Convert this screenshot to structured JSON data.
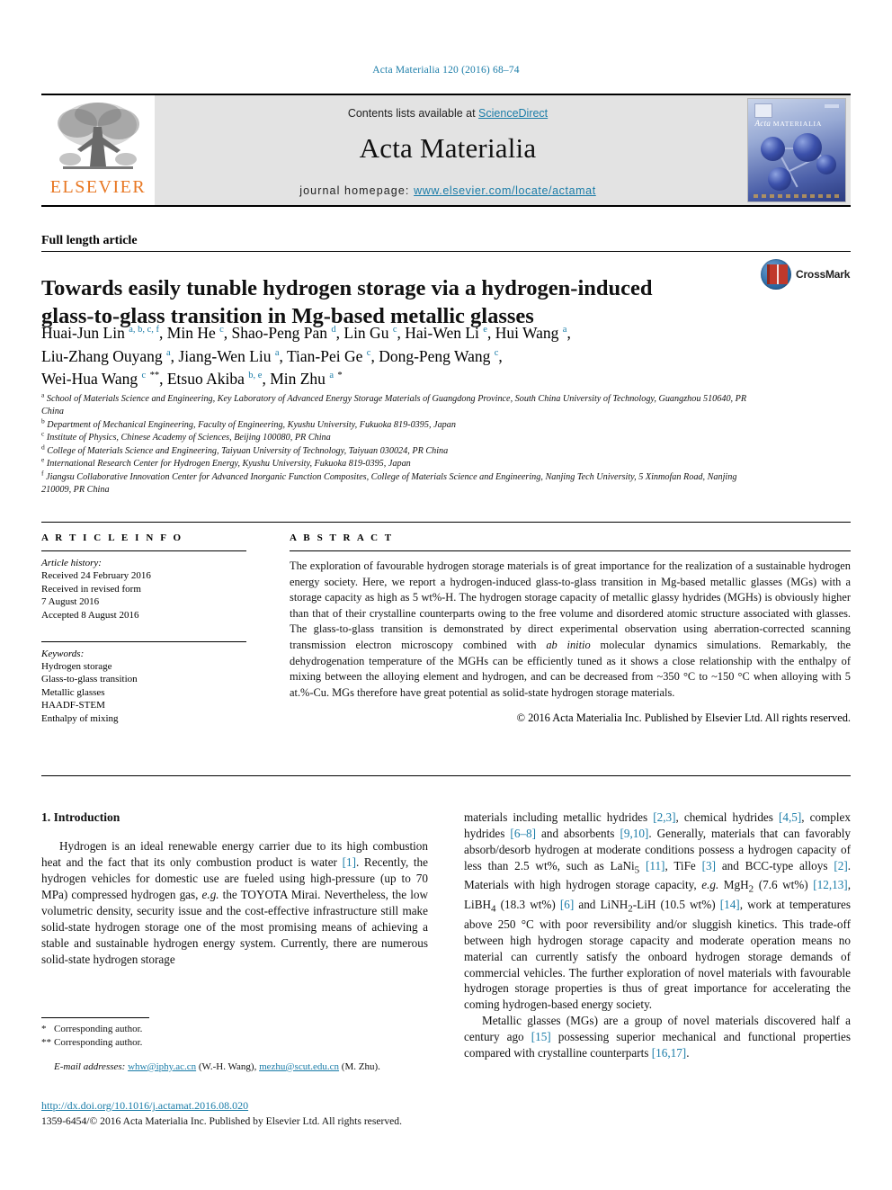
{
  "running_head": "Acta Materialia 120 (2016) 68–74",
  "masthead": {
    "contents_prefix": "Contents lists available at ",
    "sciencedirect": "ScienceDirect",
    "journal_title": "Acta Materialia",
    "homepage_prefix": "journal homepage: ",
    "homepage_url": "www.elsevier.com/locate/actamat",
    "publisher_wordmark": "ELSEVIER",
    "cover_title_italic": "Acta",
    "cover_title_rest": "MATERIALIA",
    "accent_link_color": "#1a7ca8",
    "elsevier_orange": "#e87722"
  },
  "article": {
    "type": "Full length article",
    "title": "Towards easily tunable hydrogen storage via a hydrogen-induced glass-to-glass transition in Mg-based metallic glasses",
    "crossmark_label": "CrossMark"
  },
  "authors_lines": [
    "Huai-Jun Lin a, b, c, f, Min He c, Shao-Peng Pan d, Lin Gu c, Hai-Wen Li e, Hui Wang a,",
    "Liu-Zhang Ouyang a, Jiang-Wen Liu a, Tian-Pei Ge c, Dong-Peng Wang c,",
    "Wei-Hua Wang c, **, Etsuo Akiba b, e, Min Zhu a, *"
  ],
  "affiliations": [
    {
      "marker": "a",
      "text": "School of Materials Science and Engineering, Key Laboratory of Advanced Energy Storage Materials of Guangdong Province, South China University of Technology, Guangzhou 510640, PR China"
    },
    {
      "marker": "b",
      "text": "Department of Mechanical Engineering, Faculty of Engineering, Kyushu University, Fukuoka 819-0395, Japan"
    },
    {
      "marker": "c",
      "text": "Institute of Physics, Chinese Academy of Sciences, Beijing 100080, PR China"
    },
    {
      "marker": "d",
      "text": "College of Materials Science and Engineering, Taiyuan University of Technology, Taiyuan 030024, PR China"
    },
    {
      "marker": "e",
      "text": "International Research Center for Hydrogen Energy, Kyushu University, Fukuoka 819-0395, Japan"
    },
    {
      "marker": "f",
      "text": "Jiangsu Collaborative Innovation Center for Advanced Inorganic Function Composites, College of Materials Science and Engineering, Nanjing Tech University, 5 Xinmofan Road, Nanjing 210009, PR China"
    }
  ],
  "article_info": {
    "section_label": "A R T I C L E   I N F O",
    "history_label": "Article history:",
    "history_lines": [
      "Received 24 February 2016",
      "Received in revised form",
      "7 August 2016",
      "Accepted 8 August 2016"
    ],
    "keywords_label": "Keywords:",
    "keywords": [
      "Hydrogen storage",
      "Glass-to-glass transition",
      "Metallic glasses",
      "HAADF-STEM",
      "Enthalpy of mixing"
    ]
  },
  "abstract": {
    "section_label": "A B S T R A C T",
    "text": "The exploration of favourable hydrogen storage materials is of great importance for the realization of a sustainable hydrogen energy society. Here, we report a hydrogen-induced glass-to-glass transition in Mg-based metallic glasses (MGs) with a storage capacity as high as 5 wt%-H. The hydrogen storage capacity of metallic glassy hydrides (MGHs) is obviously higher than that of their crystalline counterparts owing to the free volume and disordered atomic structure associated with glasses. The glass-to-glass transition is demonstrated by direct experimental observation using aberration-corrected scanning transmission electron microscopy combined with ",
    "italic_phrase": "ab initio",
    "text_after_italic": " molecular dynamics simulations. Remarkably, the dehydrogenation temperature of the MGHs can be efficiently tuned as it shows a close relationship with the enthalpy of mixing between the alloying element and hydrogen, and can be decreased from ~350 °C to ~150 °C when alloying with 5 at.%-Cu. MGs therefore have great potential as solid-state hydrogen storage materials.",
    "copyright": "© 2016 Acta Materialia Inc. Published by Elsevier Ltd. All rights reserved."
  },
  "introduction": {
    "heading": "1. Introduction",
    "left_paragraph_part1": "Hydrogen is an ideal renewable energy carrier due to its high combustion heat and the fact that its only combustion product is water ",
    "left_cite1": "[1]",
    "left_paragraph_part2": ". Recently, the hydrogen vehicles for domestic use are fueled using high-pressure (up to 70 MPa) compressed hydrogen gas, ",
    "left_italic_eg": "e.g.",
    "left_paragraph_part3": " the TOYOTA Mirai. Nevertheless, the low volumetric density, security issue and the cost-effective infrastructure still make solid-state hydrogen storage one of the most promising means of achieving a stable and sustainable hydrogen energy system. Currently, there are numerous solid-state hydrogen storage",
    "right_p1_a": "materials including metallic hydrides ",
    "right_cite_23": "[2,3]",
    "right_p1_b": ", chemical hydrides ",
    "right_cite_45": "[4,5]",
    "right_p1_c": ", complex hydrides ",
    "right_cite_68": "[6–8]",
    "right_p1_d": " and absorbents ",
    "right_cite_910": "[9,10]",
    "right_p1_e": ". Generally, materials that can favorably absorb/desorb hydrogen at moderate conditions possess a hydrogen capacity of less than 2.5 wt%, such as LaNi",
    "right_sub_5": "5",
    "right_p1_f": " ",
    "right_cite_11": "[11]",
    "right_p1_g": ", TiFe ",
    "right_cite_3": "[3]",
    "right_p1_h": " and BCC-type alloys ",
    "right_cite_2": "[2]",
    "right_p1_i": ". Materials with high hydrogen storage capacity, ",
    "right_italic_eg": "e.g.",
    "right_p1_j": " MgH",
    "right_sub_2a": "2",
    "right_p1_k": " (7.6 wt%) ",
    "right_cite_1213": "[12,13]",
    "right_p1_l": ", LiBH",
    "right_sub_4": "4",
    "right_p1_m": " (18.3 wt%) ",
    "right_cite_6": "[6]",
    "right_p1_n": " and LiNH",
    "right_sub_2b": "2",
    "right_p1_o": "-LiH (10.5 wt%) ",
    "right_cite_14": "[14]",
    "right_p1_p": ", work at temperatures above 250 °C with poor reversibility and/or sluggish kinetics. This trade-off between high hydrogen storage capacity and moderate operation means no material can currently satisfy the onboard hydrogen storage demands of commercial vehicles. The further exploration of novel materials with favourable hydrogen storage properties is thus of great importance for accelerating the coming hydrogen-based energy society.",
    "right_p2_a": "Metallic glasses (MGs) are a group of novel materials discovered half a century ago ",
    "right_cite_15": "[15]",
    "right_p2_b": " possessing superior mechanical and functional properties compared with crystalline counterparts ",
    "right_cite_1617": "[16,17]",
    "right_p2_c": "."
  },
  "footnotes": {
    "star_marker": "*",
    "star_text": "Corresponding author.",
    "dstar_marker": "**",
    "dstar_text": "Corresponding author.",
    "emails_label": "E-mail addresses:",
    "email1": "whw@iphy.ac.cn",
    "email1_who": "(W.-H. Wang),",
    "email2": "mezhu@scut.edu.cn",
    "email2_who": "(M. Zhu)."
  },
  "footer": {
    "doi": "http://dx.doi.org/10.1016/j.actamat.2016.08.020",
    "issn": "1359-6454/© 2016 Acta Materialia Inc. Published by Elsevier Ltd. All rights reserved."
  }
}
